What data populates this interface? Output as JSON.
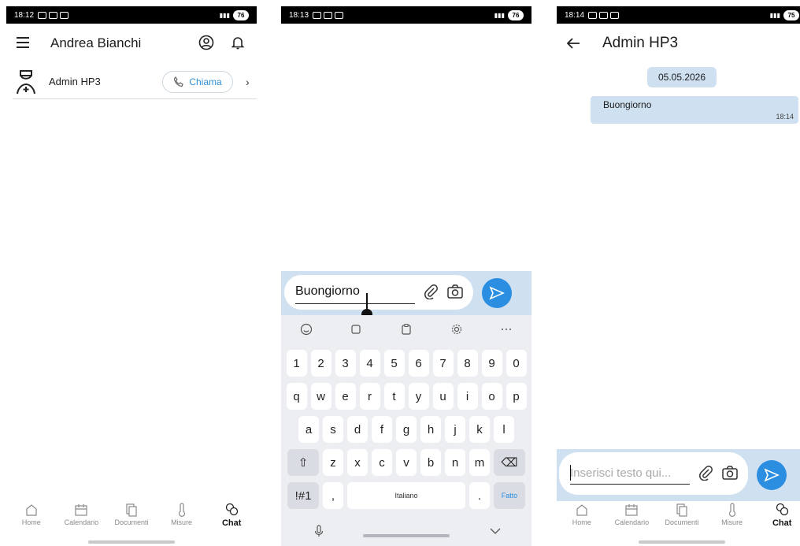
{
  "screens": [
    {
      "status": {
        "time": "18:12",
        "battery": "76"
      },
      "header": {
        "title": "Andrea Bianchi"
      },
      "contact": {
        "name": "Admin HP3",
        "call_label": "Chiama"
      },
      "nav": [
        "Home",
        "Calendario",
        "Documenti",
        "Misure",
        "Chat"
      ]
    },
    {
      "status": {
        "time": "18:13",
        "battery": "76"
      },
      "composer": {
        "text": "Buongiorno"
      },
      "keyboard": {
        "row_numbers": [
          "1",
          "2",
          "3",
          "4",
          "5",
          "6",
          "7",
          "8",
          "9",
          "0"
        ],
        "row1": [
          "q",
          "w",
          "e",
          "r",
          "t",
          "y",
          "u",
          "i",
          "o",
          "p"
        ],
        "row2": [
          "a",
          "s",
          "d",
          "f",
          "g",
          "h",
          "j",
          "k",
          "l"
        ],
        "row3": [
          "z",
          "x",
          "c",
          "v",
          "b",
          "n",
          "m"
        ],
        "symbols_label": "!#1",
        "comma": ",",
        "space_label": "Italiano",
        "period": ".",
        "done_label": "Fatto"
      }
    },
    {
      "status": {
        "time": "18:14",
        "battery": "75"
      },
      "header": {
        "title": "Admin HP3"
      },
      "date_chip": "05.05.2026",
      "message": {
        "text": "Buongiorno",
        "time": "18:14"
      },
      "composer": {
        "placeholder": "Inserisci testo qui..."
      },
      "nav": [
        "Home",
        "Calendario",
        "Documenti",
        "Misure",
        "Chat"
      ]
    }
  ],
  "colors": {
    "accent": "#2b8ee0",
    "composer_bg": "#cfe1f1"
  }
}
